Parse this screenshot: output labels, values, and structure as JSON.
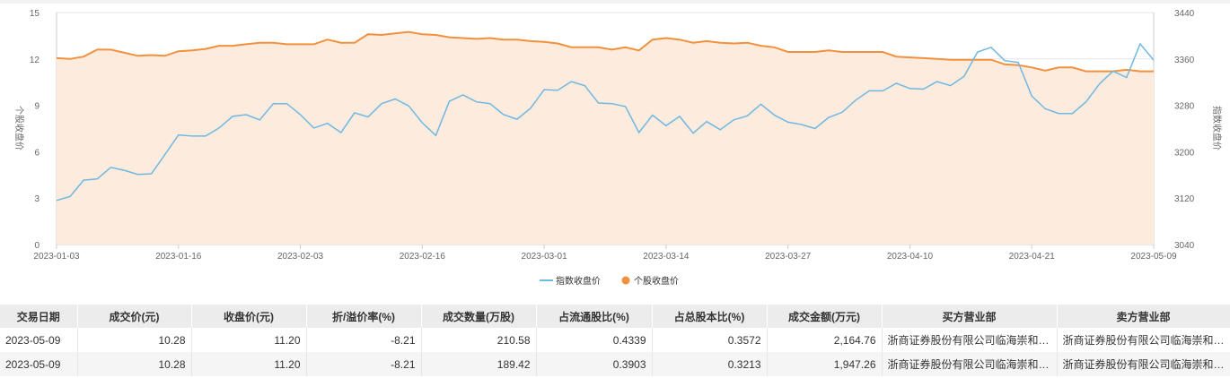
{
  "chart_data": {
    "type": "line",
    "x": [
      "2023-01-03",
      "2023-01-04",
      "2023-01-05",
      "2023-01-06",
      "2023-01-09",
      "2023-01-10",
      "2023-01-11",
      "2023-01-12",
      "2023-01-13",
      "2023-01-16",
      "2023-01-17",
      "2023-01-18",
      "2023-01-19",
      "2023-01-20",
      "2023-01-30",
      "2023-01-31",
      "2023-02-01",
      "2023-02-02",
      "2023-02-03",
      "2023-02-06",
      "2023-02-07",
      "2023-02-08",
      "2023-02-09",
      "2023-02-10",
      "2023-02-13",
      "2023-02-14",
      "2023-02-15",
      "2023-02-16",
      "2023-02-17",
      "2023-02-20",
      "2023-02-21",
      "2023-02-22",
      "2023-02-23",
      "2023-02-24",
      "2023-02-27",
      "2023-02-28",
      "2023-03-01",
      "2023-03-02",
      "2023-03-03",
      "2023-03-06",
      "2023-03-07",
      "2023-03-08",
      "2023-03-09",
      "2023-03-10",
      "2023-03-13",
      "2023-03-14",
      "2023-03-15",
      "2023-03-16",
      "2023-03-17",
      "2023-03-20",
      "2023-03-21",
      "2023-03-22",
      "2023-03-23",
      "2023-03-24",
      "2023-03-27",
      "2023-03-28",
      "2023-03-29",
      "2023-03-30",
      "2023-03-31",
      "2023-04-03",
      "2023-04-04",
      "2023-04-06",
      "2023-04-07",
      "2023-04-10",
      "2023-04-11",
      "2023-04-12",
      "2023-04-13",
      "2023-04-14",
      "2023-04-17",
      "2023-04-18",
      "2023-04-19",
      "2023-04-20",
      "2023-04-21",
      "2023-04-24",
      "2023-04-25",
      "2023-04-26",
      "2023-04-27",
      "2023-04-28",
      "2023-05-04",
      "2023-05-05",
      "2023-05-08",
      "2023-05-09"
    ],
    "x_ticks": [
      "2023-01-03",
      "2023-01-16",
      "2023-02-03",
      "2023-02-16",
      "2023-03-01",
      "2023-03-14",
      "2023-03-27",
      "2023-04-10",
      "2023-04-21",
      "2023-05-09"
    ],
    "series": [
      {
        "name": "指数收盘价",
        "axis": "right",
        "color": "#6fb8e2",
        "values": [
          3116,
          3123,
          3151,
          3153,
          3173,
          3168,
          3161,
          3162,
          3195,
          3229,
          3227,
          3227,
          3241,
          3261,
          3264,
          3255,
          3283,
          3283,
          3264,
          3241,
          3249,
          3233,
          3267,
          3260,
          3283,
          3291,
          3279,
          3250,
          3228,
          3287,
          3298,
          3286,
          3283,
          3264,
          3256,
          3275,
          3307,
          3306,
          3321,
          3314,
          3284,
          3283,
          3278,
          3233,
          3263,
          3245,
          3261,
          3232,
          3252,
          3238,
          3255,
          3262,
          3282,
          3263,
          3251,
          3247,
          3240,
          3259,
          3268,
          3289,
          3305,
          3305,
          3318,
          3309,
          3308,
          3321,
          3314,
          3330,
          3372,
          3380,
          3357,
          3354,
          3296,
          3274,
          3266,
          3266,
          3286,
          3317,
          3339,
          3328,
          3386,
          3358
        ]
      },
      {
        "name": "个股收盘价",
        "axis": "left",
        "color": "#f2913d",
        "values": [
          12.05,
          12.0,
          12.15,
          12.6,
          12.6,
          12.4,
          12.2,
          12.25,
          12.2,
          12.5,
          12.55,
          12.65,
          12.85,
          12.85,
          12.95,
          13.05,
          13.05,
          12.95,
          12.95,
          12.95,
          13.25,
          13.05,
          13.05,
          13.6,
          13.55,
          13.65,
          13.75,
          13.6,
          13.55,
          13.4,
          13.35,
          13.3,
          13.35,
          13.25,
          13.25,
          13.15,
          13.1,
          13.0,
          12.75,
          12.75,
          12.75,
          12.6,
          12.75,
          12.55,
          13.25,
          13.35,
          13.25,
          13.05,
          13.15,
          13.05,
          13.0,
          13.05,
          12.85,
          12.75,
          12.45,
          12.45,
          12.45,
          12.55,
          12.45,
          12.45,
          12.45,
          12.45,
          12.15,
          12.1,
          12.05,
          12.0,
          11.95,
          11.95,
          11.95,
          11.95,
          11.65,
          11.6,
          11.45,
          11.25,
          11.45,
          11.45,
          11.2,
          11.2,
          11.2,
          11.3,
          11.2,
          11.2
        ]
      }
    ],
    "ylabel_left": "个股收盘价",
    "ylabel_right": "指数收盘价",
    "ylim_left": [
      0,
      15
    ],
    "ylim_right": [
      3040,
      3440
    ],
    "yticks_left": [
      0,
      3,
      6,
      9,
      12,
      15
    ],
    "yticks_right": [
      3040,
      3120,
      3200,
      3280,
      3360,
      3440
    ],
    "grid": true,
    "legend_placement": "bottom-center",
    "fill_color": "#fdebde"
  },
  "table": {
    "headers": [
      "交易日期",
      "成交价(元)",
      "收盘价(元)",
      "折/溢价率(%)",
      "成交数量(万股)",
      "占流通股比(%)",
      "占总股本比(%)",
      "成交金额(万元)",
      "买方营业部",
      "卖方营业部"
    ],
    "rows": [
      [
        "2023-05-09",
        "10.28",
        "11.20",
        "-8.21",
        "210.58",
        "0.4339",
        "0.3572",
        "2,164.76",
        "浙商证券股份有限公司临海崇和路…",
        "浙商证券股份有限公司临海崇和…"
      ],
      [
        "2023-05-09",
        "10.28",
        "11.20",
        "-8.21",
        "189.42",
        "0.3903",
        "0.3213",
        "1,947.26",
        "浙商证券股份有限公司临海崇和路…",
        "浙商证券股份有限公司临海崇和…"
      ]
    ]
  }
}
